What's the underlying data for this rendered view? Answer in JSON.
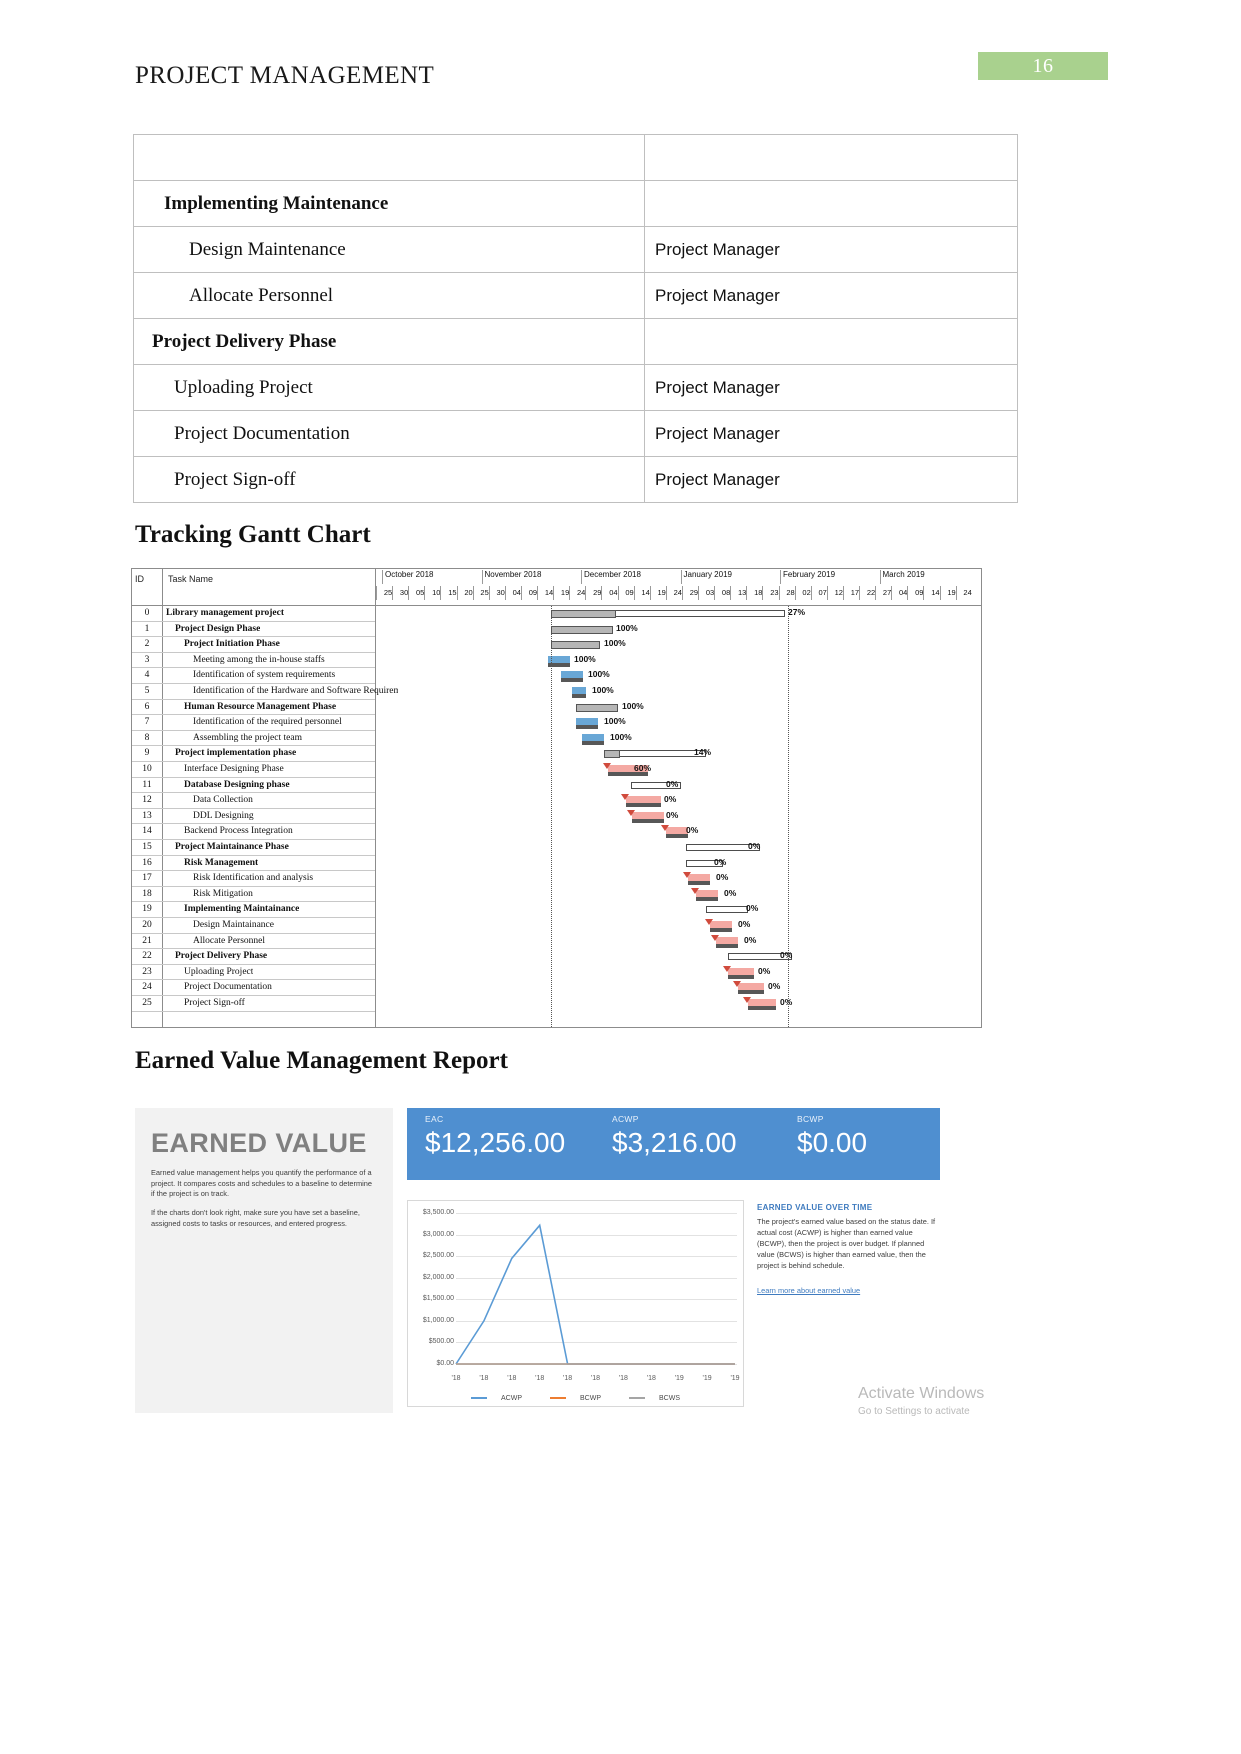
{
  "header": {
    "doc_title": "PROJECT MANAGEMENT",
    "page_number": "16",
    "badge_color": "#a9d18e"
  },
  "responsibility_table": {
    "rows": [
      {
        "task": "",
        "owner": "",
        "level": 0
      },
      {
        "task": "Implementing Maintenance",
        "owner": "",
        "level": 1
      },
      {
        "task": "Design Maintenance",
        "owner": "Project Manager",
        "level": 2
      },
      {
        "task": "Allocate Personnel",
        "owner": "Project Manager",
        "level": 2
      },
      {
        "task": "Project Delivery Phase",
        "owner": "",
        "level": 0
      },
      {
        "task": "Uploading Project",
        "owner": "Project Manager",
        "level": 3
      },
      {
        "task": "Project Documentation",
        "owner": "Project Manager",
        "level": 3
      },
      {
        "task": "Project Sign-off",
        "owner": "Project Manager",
        "level": 3
      }
    ]
  },
  "sections": {
    "gantt_heading": "Tracking Gantt Chart",
    "evm_heading": "Earned Value Management Report"
  },
  "gantt": {
    "col_id": "ID",
    "col_name": "Task Name",
    "months": [
      "October 2018",
      "November 2018",
      "December 2018",
      "January 2019",
      "February 2019",
      "March 2019"
    ],
    "day_ticks": [
      "25",
      "30",
      "05",
      "10",
      "15",
      "20",
      "25",
      "30",
      "04",
      "09",
      "14",
      "19",
      "24",
      "29",
      "04",
      "09",
      "14",
      "19",
      "24",
      "29",
      "03",
      "08",
      "13",
      "18",
      "23",
      "28",
      "02",
      "07",
      "12",
      "17",
      "22",
      "27",
      "04",
      "09",
      "14",
      "19",
      "24"
    ],
    "tasks": [
      {
        "id": "0",
        "name": "Library management project",
        "bold": true,
        "indent": 0,
        "pct": "27%"
      },
      {
        "id": "1",
        "name": "Project Design Phase",
        "bold": true,
        "indent": 1,
        "pct": "100%"
      },
      {
        "id": "2",
        "name": "Project Initiation Phase",
        "bold": true,
        "indent": 2,
        "pct": "100%"
      },
      {
        "id": "3",
        "name": "Meeting among the in-house staffs",
        "bold": false,
        "indent": 3,
        "pct": "100%"
      },
      {
        "id": "4",
        "name": "Identification of system requirements",
        "bold": false,
        "indent": 3,
        "pct": "100%"
      },
      {
        "id": "5",
        "name": "Identification of the Hardware and Software Requirements",
        "bold": false,
        "indent": 3,
        "pct": "100%"
      },
      {
        "id": "6",
        "name": "Human Resource Management Phase",
        "bold": true,
        "indent": 2,
        "pct": "100%"
      },
      {
        "id": "7",
        "name": "Identification of the required personnel",
        "bold": false,
        "indent": 3,
        "pct": "100%"
      },
      {
        "id": "8",
        "name": "Assembling the project team",
        "bold": false,
        "indent": 3,
        "pct": "100%"
      },
      {
        "id": "9",
        "name": "Project implementation phase",
        "bold": true,
        "indent": 1,
        "pct": "14%"
      },
      {
        "id": "10",
        "name": "Interface Designing Phase",
        "bold": false,
        "indent": 2,
        "pct": "60%"
      },
      {
        "id": "11",
        "name": "Database Designing phase",
        "bold": true,
        "indent": 2,
        "pct": "0%"
      },
      {
        "id": "12",
        "name": "Data Collection",
        "bold": false,
        "indent": 3,
        "pct": "0%"
      },
      {
        "id": "13",
        "name": "DDL Designing",
        "bold": false,
        "indent": 3,
        "pct": "0%"
      },
      {
        "id": "14",
        "name": "Backend Process Integration",
        "bold": false,
        "indent": 2,
        "pct": "0%"
      },
      {
        "id": "15",
        "name": "Project Maintainance Phase",
        "bold": true,
        "indent": 1,
        "pct": "0%"
      },
      {
        "id": "16",
        "name": "Risk Management",
        "bold": true,
        "indent": 2,
        "pct": "0%"
      },
      {
        "id": "17",
        "name": "Risk Identification and analysis",
        "bold": false,
        "indent": 3,
        "pct": "0%"
      },
      {
        "id": "18",
        "name": "Risk Mitigation",
        "bold": false,
        "indent": 3,
        "pct": "0%"
      },
      {
        "id": "19",
        "name": "Implementing Maintainance",
        "bold": true,
        "indent": 2,
        "pct": "0%"
      },
      {
        "id": "20",
        "name": "Design Maintainance",
        "bold": false,
        "indent": 3,
        "pct": "0%"
      },
      {
        "id": "21",
        "name": "Allocate Personnel",
        "bold": false,
        "indent": 3,
        "pct": "0%"
      },
      {
        "id": "22",
        "name": "Project Delivery Phase",
        "bold": true,
        "indent": 1,
        "pct": "0%"
      },
      {
        "id": "23",
        "name": "Uploading Project",
        "bold": false,
        "indent": 2,
        "pct": "0%"
      },
      {
        "id": "24",
        "name": "Project Documentation",
        "bold": false,
        "indent": 2,
        "pct": "0%"
      },
      {
        "id": "25",
        "name": "Project Sign-off",
        "bold": false,
        "indent": 2,
        "pct": "0%"
      }
    ]
  },
  "evm": {
    "panel_title": "EARNED VALUE",
    "paragraph_1": "Earned value management helps you quantify the performance of a project. It compares costs and schedules to a baseline to determine if the project is on track.",
    "paragraph_2": "If the charts don't look right, make sure you have set a baseline, assigned costs to tasks or resources, and entered progress.",
    "kpis": [
      {
        "label": "EAC",
        "value": "$12,256.00"
      },
      {
        "label": "ACWP",
        "value": "$3,216.00"
      },
      {
        "label": "BCWP",
        "value": "$0.00"
      }
    ],
    "side_heading": "EARNED VALUE OVER TIME",
    "side_paragraph": "The project's earned value based on the status date.  If actual cost (ACWP) is higher than earned value (BCWP), then the project is over budget.  If planned value (BCWS) is higher than earned value, then the project is behind schedule.",
    "side_link": "Learn more about earned value"
  },
  "chart_data": {
    "type": "line",
    "title": "EARNED VALUE OVER TIME",
    "xlabel": "",
    "ylabel": "",
    "ylim": [
      0,
      3500
    ],
    "ytick_labels": [
      "$3,500.00",
      "$3,000.00",
      "$2,500.00",
      "$2,000.00",
      "$1,500.00",
      "$1,000.00",
      "$500.00",
      "$0.00"
    ],
    "ytick_values": [
      3500,
      3000,
      2500,
      2000,
      1500,
      1000,
      500,
      0
    ],
    "categories": [
      "'18",
      "'18",
      "'18",
      "'18",
      "'18",
      "'18",
      "'18",
      "'18",
      "'19",
      "'19",
      "'19"
    ],
    "legend": [
      "ACWP",
      "BCWP",
      "BCWS"
    ],
    "legend_position": "bottom",
    "grid": true,
    "series": [
      {
        "name": "ACWP",
        "color": "#5b9bd5",
        "values": [
          0,
          1000,
          2450,
          3216,
          0,
          0,
          0,
          0,
          0,
          0,
          0
        ]
      },
      {
        "name": "BCWP",
        "color": "#ed7d31",
        "values": [
          0,
          0,
          0,
          0,
          0,
          0,
          0,
          0,
          0,
          0,
          0
        ]
      },
      {
        "name": "BCWS",
        "color": "#a5a5a5",
        "values": [
          0,
          0,
          0,
          0,
          0,
          0,
          0,
          0,
          0,
          0,
          0
        ]
      }
    ]
  },
  "watermark": {
    "line1": "Activate Windows",
    "line2": "Go to Settings to activate"
  }
}
